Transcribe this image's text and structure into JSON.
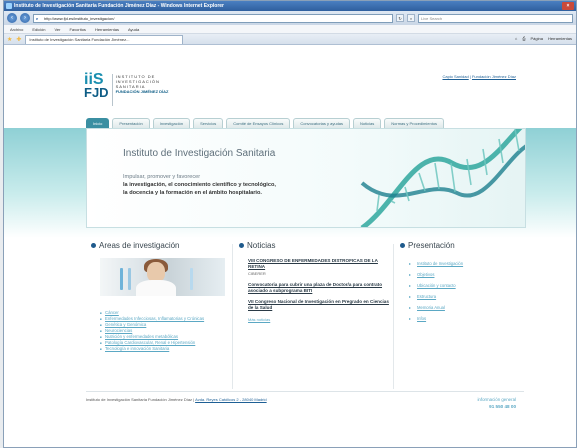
{
  "browser": {
    "title": "Instituto de Investigación Sanitaria Fundación Jiménez Díaz - Windows Internet Explorer",
    "url": "http://www.fjd.es/instituto_investigacion/",
    "search_placeholder": "Live Search",
    "menu": [
      "Archivo",
      "Edición",
      "Ver",
      "Favoritos",
      "Herramientas",
      "Ayuda"
    ],
    "tab_label": "Instituto de Investigación Sanitaria Fundación Jiménez...",
    "tools": [
      "Página",
      "Herramientas"
    ]
  },
  "site": {
    "logo": {
      "mark_top": "iiS",
      "mark_bottom": "FJD",
      "line1": "INSTITUTO DE",
      "line2": "INVESTIGACIÓN",
      "line3": "SANITARIA",
      "line4": "FUNDACIÓN JIMÉNEZ DÍAZ"
    },
    "top_links": {
      "a": "Capio Sanidad",
      "sep": " | ",
      "b": "Fundación Jiménez Díaz"
    },
    "nav": [
      "Inicio",
      "Presentación",
      "Investigación",
      "Servicios",
      "Comité de Ensayos Clínicos",
      "Convocatorias y ayudas",
      "Noticias",
      "Normas y Procedimientos"
    ],
    "banner": {
      "title": "Instituto de Investigación Sanitaria",
      "intro": "Impulsar, promover y favorecer",
      "line1": "la investigación, el conocimiento científico y tecnológico,",
      "line2": "la docencia y la formación en el ámbito hospitalario."
    },
    "areas": {
      "title": "Areas de investigación",
      "items": [
        "Cáncer",
        "Enfermedades Infecciosas, Inflamatorias y Crónicas",
        "Genética y Genómica",
        "Neurociencias",
        "Nutrición y enfermedades metabólicas",
        "Patología Cardiovascular, Renal e Hipertensión",
        "Tecnología e innovación Sanitaria"
      ]
    },
    "news": {
      "title": "Noticias",
      "items": [
        {
          "headline": "VIII CONGRESO DE ENFERMEDADES DISTROFICAS DE LA RETINA",
          "source": "CIBERER"
        },
        {
          "headline": "Convocatoria para cubrir una plaza de Doctor/a para contrato asociado a subprograma BITI",
          "source": ""
        },
        {
          "headline": "VII Congreso Nacional de Investigación en Pregrado en Ciencias de la Salud",
          "source": ""
        }
      ],
      "more": "Más noticias"
    },
    "presentation": {
      "title": "Presentación",
      "items": [
        "Instituto de Investigación",
        "Objetivos",
        "Ubicación y contacto",
        "Estructura",
        "Memoria Anual",
        "Infos"
      ]
    },
    "footer": {
      "text": "Instituto de Investigación Sanitaria Fundación Jiménez Díaz | ",
      "address": "Avda. Reyes Católicos 2 - 28040 Madrid",
      "info_label": "información general",
      "phone": "91 550 48 00"
    }
  }
}
